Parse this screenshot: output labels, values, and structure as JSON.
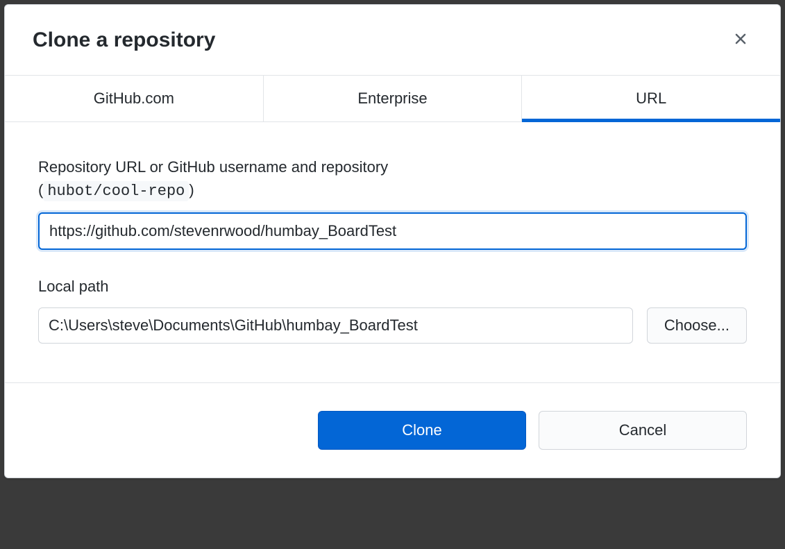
{
  "dialog": {
    "title": "Clone a repository"
  },
  "tabs": {
    "github": "GitHub.com",
    "enterprise": "Enterprise",
    "url": "URL",
    "active": "url"
  },
  "form": {
    "repo_label_main": "Repository URL or GitHub username and repository",
    "repo_example_open": "(",
    "repo_example_code": "hubot/cool-repo",
    "repo_example_close": ")",
    "repo_url_value": "https://github.com/stevenrwood/humbay_BoardTest",
    "local_path_label": "Local path",
    "local_path_value": "C:\\Users\\steve\\Documents\\GitHub\\humbay_BoardTest",
    "choose_label": "Choose..."
  },
  "footer": {
    "clone_label": "Clone",
    "cancel_label": "Cancel"
  }
}
